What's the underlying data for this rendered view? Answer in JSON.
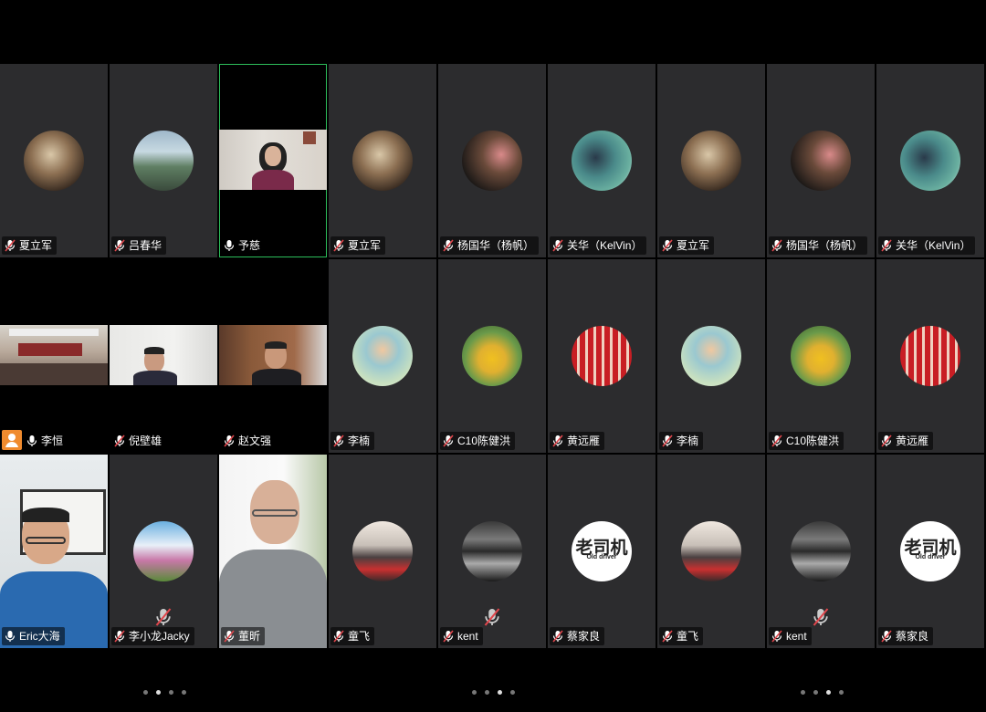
{
  "participants": {
    "t1": "夏立军",
    "t2": "吕春华",
    "t3": "予慈",
    "t4": "夏立军",
    "t5": "杨国华（杨帆）",
    "t6": "关华（KelVin）",
    "t7": "夏立军",
    "t8": "杨国华（杨帆）",
    "t9": "关华（KelVin）",
    "t10": "李恒",
    "t11": "倪壁雄",
    "t12": "赵文强",
    "t13": "李楠",
    "t14": "C10陈健洪",
    "t15": "黄远雁",
    "t16": "李楠",
    "t17": "C10陈健洪",
    "t18": "黄远雁",
    "t19": "Eric大海",
    "t20": "李小龙Jacky",
    "t21": "董昕",
    "t22": "童飞",
    "t23": "kent",
    "t24": "蔡家良",
    "t25": "童飞",
    "t26": "kent",
    "t27": "蔡家良"
  },
  "logo": {
    "main": "老司机",
    "sub": "Old driver"
  },
  "colors": {
    "tile": "#2c2c2e",
    "active_border": "#2dbd5a",
    "host_badge": "#f08b2e",
    "mute": "#e0464c"
  },
  "pagers": [
    {
      "count": 4,
      "active": 1
    },
    {
      "count": 4,
      "active": 2
    },
    {
      "count": 4,
      "active": 2
    }
  ]
}
